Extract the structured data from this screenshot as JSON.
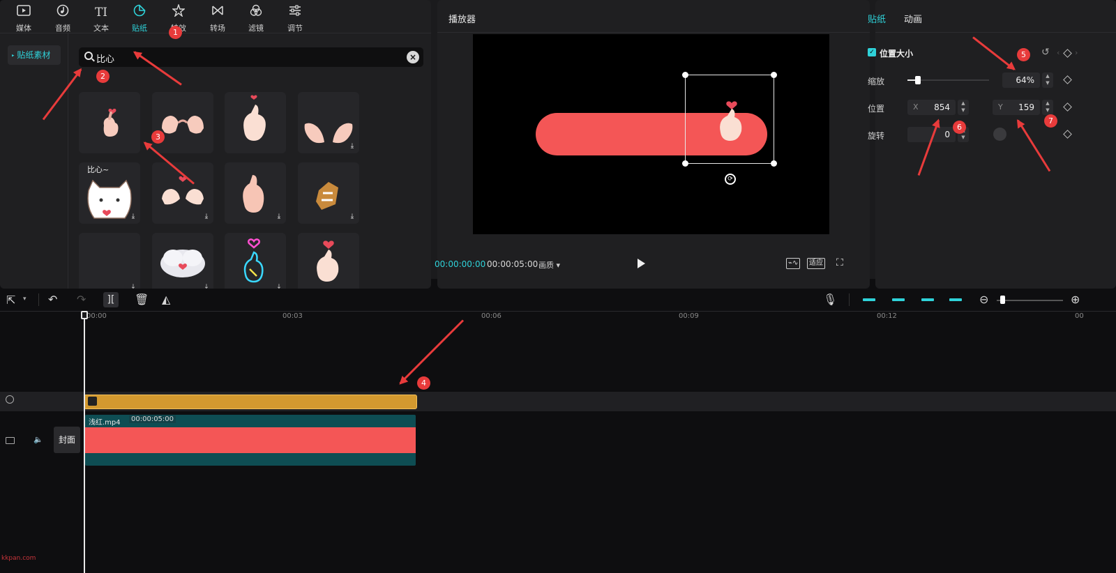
{
  "categories": [
    {
      "label": "媒体",
      "icon": "media-icon"
    },
    {
      "label": "音频",
      "icon": "audio-icon"
    },
    {
      "label": "文本",
      "icon": "text-icon"
    },
    {
      "label": "贴纸",
      "icon": "sticker-icon"
    },
    {
      "label": "特效",
      "icon": "effects-icon"
    },
    {
      "label": "转场",
      "icon": "transition-icon"
    },
    {
      "label": "滤镜",
      "icon": "filter-icon"
    },
    {
      "label": "调节",
      "icon": "adjust-icon"
    }
  ],
  "active_category": "贴纸",
  "side_nav": {
    "item": "贴纸素材"
  },
  "search": {
    "value": "比心"
  },
  "stickers": [
    {
      "name": "heart-hand-small",
      "download": false
    },
    {
      "name": "two-hands-heart",
      "download": false
    },
    {
      "name": "finger-heart",
      "download": false
    },
    {
      "name": "open-hands",
      "download": true
    },
    {
      "name": "cat-bixin",
      "label": "比心~",
      "download": true
    },
    {
      "name": "pinch-heart",
      "download": true
    },
    {
      "name": "finger-snap",
      "download": true
    },
    {
      "name": "cookie-heart",
      "download": true
    },
    {
      "name": "blank",
      "download": true
    },
    {
      "name": "cloud-heart",
      "download": true
    },
    {
      "name": "neon-heart",
      "download": true
    },
    {
      "name": "heart-hand",
      "download": false
    }
  ],
  "player": {
    "title": "播放器",
    "current_time": "00:00:00:00",
    "total_time": "00:00:05:00",
    "quality": "画质",
    "fit_label": "适应"
  },
  "props": {
    "tabs": [
      "贴纸",
      "动画"
    ],
    "active_tab": "贴纸",
    "section": "位置大小",
    "scale_label": "缩放",
    "scale_value": "64%",
    "scale_fraction": 0.13,
    "position_label": "位置",
    "x_axis": "X",
    "x_value": "854",
    "y_axis": "Y",
    "y_value": "159",
    "rotate_label": "旋转",
    "rotate_value": "0"
  },
  "timeline": {
    "ruler": [
      "00:00",
      "00:03",
      "00:06",
      "00:09",
      "00:12",
      "00"
    ],
    "clip_name": "浅红.mp4",
    "clip_duration": "00:00:05:00",
    "cover_label": "封面",
    "zoom_level": 0.05
  },
  "annotations": [
    "1",
    "2",
    "3",
    "4",
    "5",
    "6",
    "7"
  ],
  "watermark": "kkpan.com",
  "colors": {
    "accent": "#2fd2d9",
    "sticker_clip": "#d3992f",
    "video_clip": "#0e4d53",
    "shape": "#f45656",
    "annotation": "#e83b3b"
  }
}
